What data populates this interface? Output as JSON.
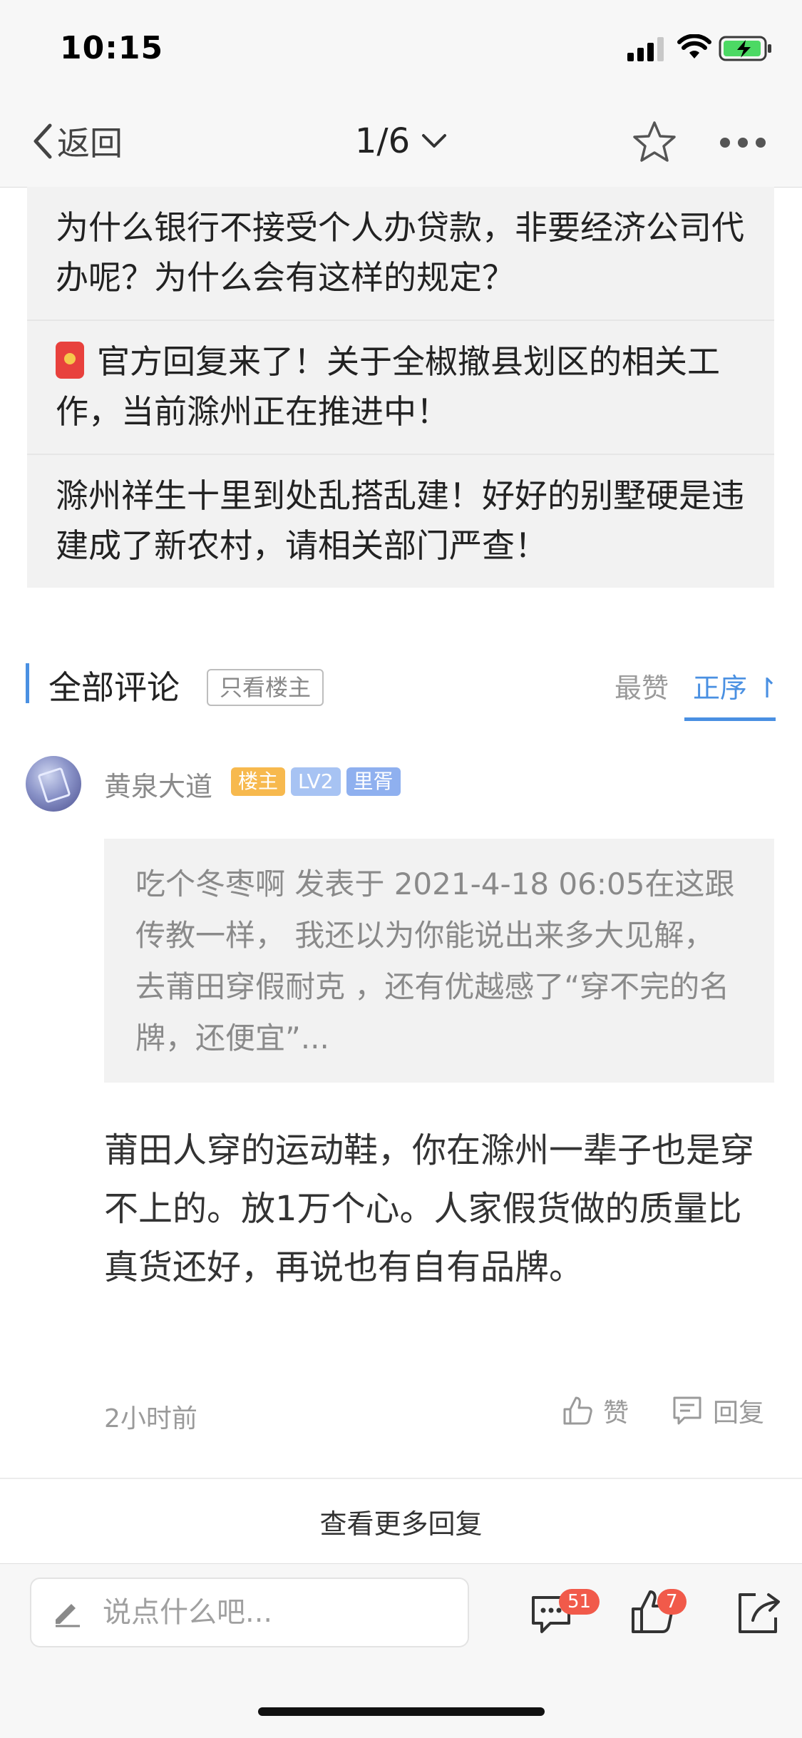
{
  "status": {
    "time": "10:15"
  },
  "nav": {
    "back_label": "返回",
    "pager": "1/6"
  },
  "related": [
    {
      "text": "为什么银行不接受个人办贷款，非要经济公司代办呢？为什么会有这样的规定？"
    },
    {
      "text": "官方回复来了！关于全椒撤县划区的相关工作，当前滁州正在推进中！"
    },
    {
      "text": "滁州祥生十里到处乱搭乱建！好好的别墅硬是违建成了新农村，请相关部门严查！"
    }
  ],
  "comments_header": {
    "title": "全部评论",
    "only_op": "只看楼主",
    "sort_hot": "最赞",
    "sort_order": "正序 ↾"
  },
  "comment": {
    "username": "黄泉大道",
    "badges": [
      "楼主",
      "LV2",
      "里胥"
    ],
    "quote": "吃个冬枣啊 发表于 2021-4-18 06:05在这跟传教一样， 我还以为你能说出来多大见解，去莆田穿假耐克 ，还有优越感了“穿不完的名牌，还便宜”...",
    "body": "莆田人穿的运动鞋，你在滁州一辈子也是穿不上的。放1万个心。人家假货做的质量比真货还好，再说也有自有品牌。",
    "time": "2小时前",
    "like_label": "赞",
    "reply_label": "回复"
  },
  "more_replies": "查看更多回复",
  "bottom_bar": {
    "input_placeholder": "说点什么吧...",
    "comment_count": "51",
    "like_count": "7"
  },
  "colors": {
    "accent": "#4a90e2",
    "badge_op": "#f7b94e",
    "badge_level": "#a7c3f3",
    "count_red": "#f15a4a"
  }
}
